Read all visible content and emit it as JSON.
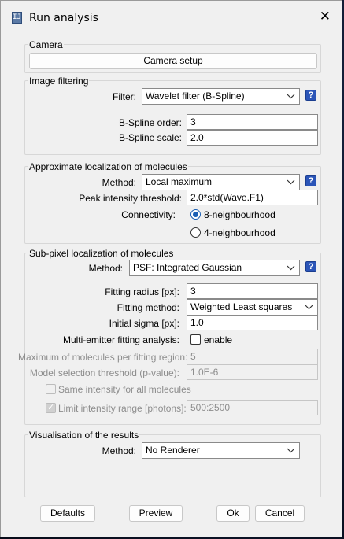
{
  "window": {
    "title": "Run analysis",
    "icon": "app-icon",
    "close_icon": "close-icon"
  },
  "camera": {
    "legend": "Camera",
    "setup_button": "Camera setup"
  },
  "image_filtering": {
    "legend": "Image filtering",
    "filter_label": "Filter:",
    "filter_value": "Wavelet filter (B-Spline)",
    "order_label": "B-Spline order:",
    "order_value": "3",
    "scale_label": "B-Spline scale:",
    "scale_value": "2.0"
  },
  "approx": {
    "legend": "Approximate localization of molecules",
    "method_label": "Method:",
    "method_value": "Local maximum",
    "threshold_label": "Peak intensity threshold:",
    "threshold_value": "2.0*std(Wave.F1)",
    "connectivity_label": "Connectivity:",
    "conn_8": "8-neighbourhood",
    "conn_4": "4-neighbourhood",
    "connectivity_selected": "8-neighbourhood"
  },
  "subpixel": {
    "legend": "Sub-pixel localization of molecules",
    "method_label": "Method:",
    "method_value": "PSF: Integrated Gaussian",
    "radius_label": "Fitting radius [px]:",
    "radius_value": "3",
    "fitting_method_label": "Fitting method:",
    "fitting_method_value": "Weighted Least squares",
    "sigma_label": "Initial sigma [px]:",
    "sigma_value": "1.0",
    "multi_label": "Multi-emitter fitting analysis:",
    "multi_enable": "enable",
    "max_mol_label": "Maximum of molecules per fitting region:",
    "max_mol_value": "5",
    "model_sel_label": "Model selection threshold (p-value):",
    "model_sel_value": "1.0E-6",
    "same_intensity_label": "Same intensity for all molecules",
    "limit_intensity_label": "Limit intensity range [photons]:",
    "limit_intensity_value": "500:2500"
  },
  "visualisation": {
    "legend": "Visualisation of the results",
    "method_label": "Method:",
    "method_value": "No Renderer"
  },
  "footer": {
    "defaults": "Defaults",
    "preview": "Preview",
    "ok": "Ok",
    "cancel": "Cancel"
  },
  "colors": {
    "dialog_bg": "#f0f0f0",
    "accent": "#1a5fb4",
    "help_icon": "#2b55b8"
  }
}
